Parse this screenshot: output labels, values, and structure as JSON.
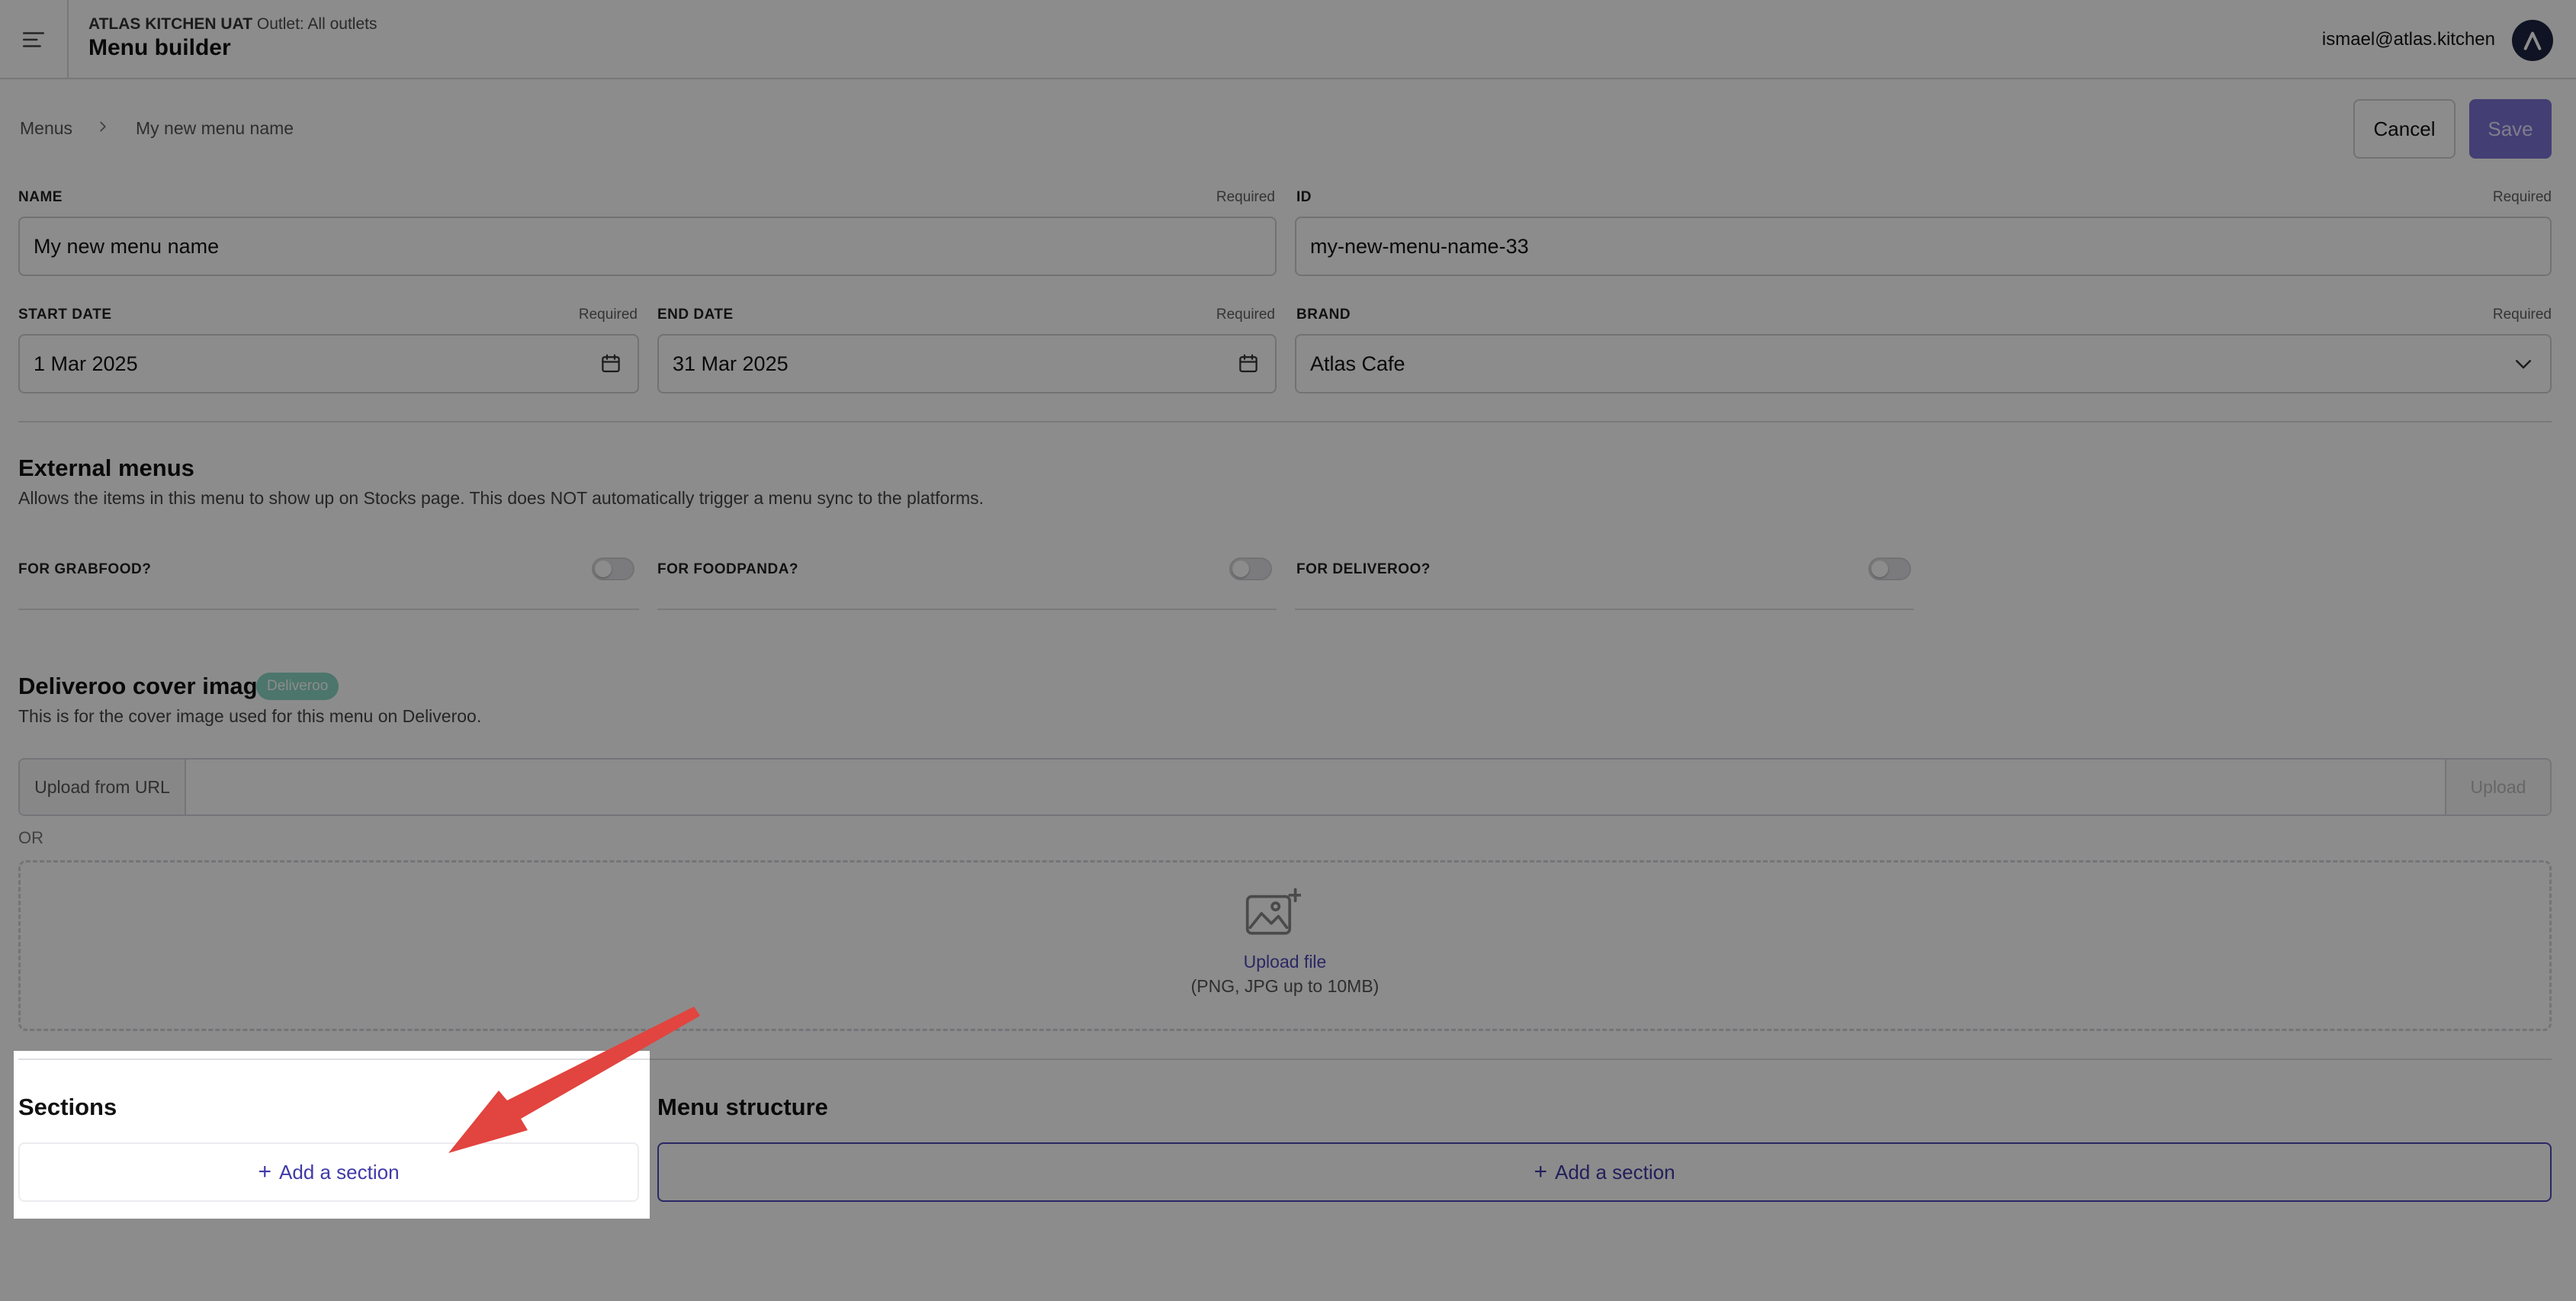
{
  "header": {
    "org_name": "ATLAS KITCHEN UAT",
    "outlet": "Outlet: All outlets",
    "title": "Menu builder",
    "user_email": "ismael@atlas.kitchen",
    "menu_icon": "hamburger-menu-icon",
    "avatar_icon": "atlas-logo-icon"
  },
  "breadcrumb": {
    "items": [
      "Menus",
      "My new menu name"
    ],
    "separator_icon": "chevron-right-icon"
  },
  "actions": {
    "cancel": "Cancel",
    "save": "Save"
  },
  "form": {
    "required_text": "Required",
    "name": {
      "label": "NAME",
      "value": "My new menu name"
    },
    "id": {
      "label": "ID",
      "value": "my-new-menu-name-33"
    },
    "start_date": {
      "label": "START DATE",
      "value": "1 Mar 2025"
    },
    "end_date": {
      "label": "END DATE",
      "value": "31 Mar 2025"
    },
    "brand": {
      "label": "BRAND",
      "value": "Atlas Cafe"
    }
  },
  "external_menus": {
    "title": "External menus",
    "description": "Allows the items in this menu to show up on Stocks page. This does NOT automatically trigger a menu sync to the platforms.",
    "toggles": [
      {
        "label": "FOR GRABFOOD?",
        "on": false
      },
      {
        "label": "FOR FOODPANDA?",
        "on": false
      },
      {
        "label": "FOR DELIVEROO?",
        "on": false
      }
    ]
  },
  "cover_image": {
    "title": "Deliveroo cover image",
    "badge": "Deliveroo",
    "description": "This is for the cover image used for this menu on Deliveroo.",
    "url_prefix": "Upload from URL",
    "upload_button": "Upload",
    "or_text": "OR",
    "upload_link": "Upload file",
    "upload_hint": "(PNG, JPG up to 10MB)"
  },
  "sections": {
    "title": "Sections",
    "add_label": "Add a section"
  },
  "menu_structure": {
    "title": "Menu structure",
    "add_label": "Add a section"
  },
  "colors": {
    "accent": "#4d47b8",
    "save_button": "#7b72d3",
    "badge": "#8bd5c3",
    "arrow": "#e2443f",
    "overlay": "rgba(0,0,0,0.45)"
  }
}
